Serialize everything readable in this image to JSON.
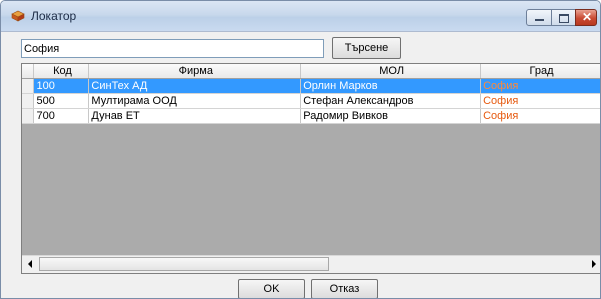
{
  "window": {
    "title": "Локатор",
    "icon": "app-icon"
  },
  "search": {
    "value": "София",
    "button_label": "Търсене"
  },
  "grid": {
    "columns": [
      "Код",
      "Фирма",
      "МОЛ",
      "Град"
    ],
    "rows": [
      {
        "code": "100",
        "company": "СинТех АД",
        "mol": "Орлин Марков",
        "city": "София",
        "selected": true
      },
      {
        "code": "500",
        "company": "Мултирама ООД",
        "mol": "Стефан Александров",
        "city": "София",
        "selected": false
      },
      {
        "code": "700",
        "company": "Дунав ЕТ",
        "mol": "Радомир Вивков",
        "city": "София",
        "selected": false
      }
    ]
  },
  "footer": {
    "ok_label": "OK",
    "cancel_label": "Отказ"
  },
  "colors": {
    "selection": "#3399ff",
    "city_text": "#e65a10"
  }
}
